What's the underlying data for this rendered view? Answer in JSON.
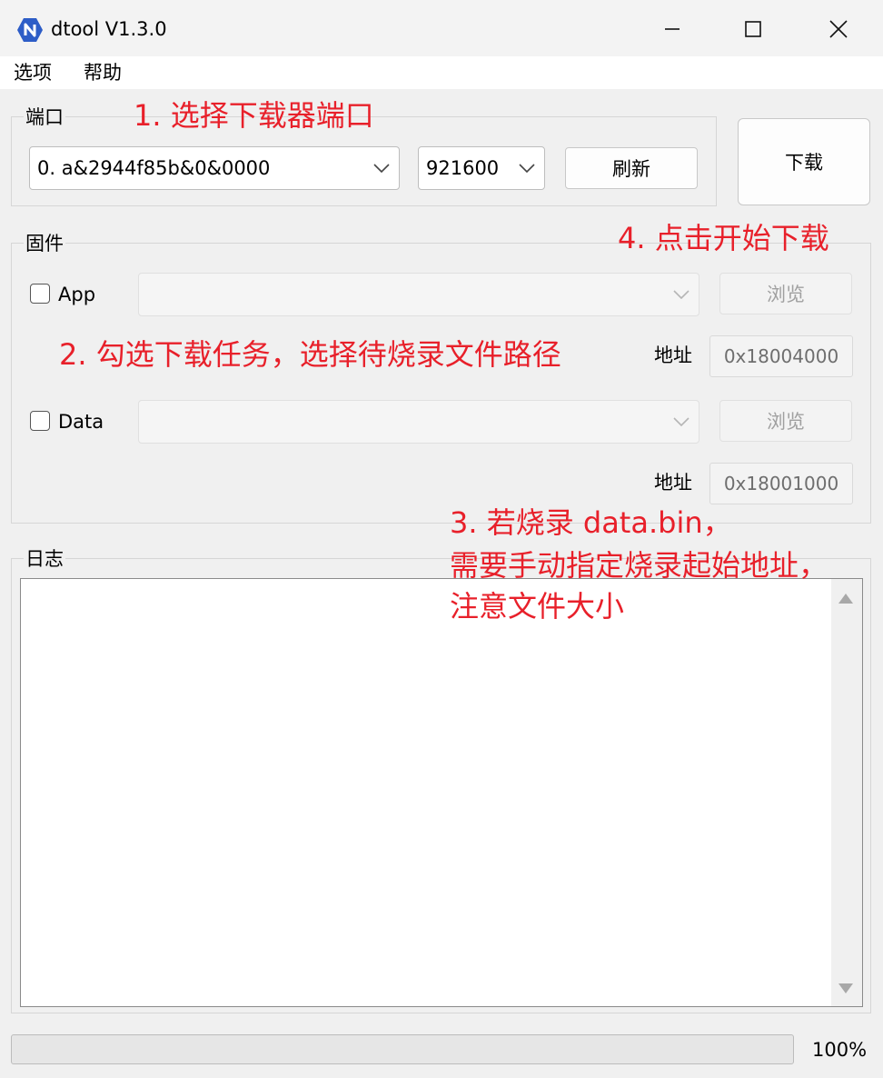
{
  "window": {
    "title": "dtool V1.3.0"
  },
  "menu": [
    "选项",
    "帮助"
  ],
  "port_group": {
    "label": "端口",
    "port_value": "0. a&2944f85b&0&0000",
    "baud_value": "921600",
    "refresh_label": "刷新"
  },
  "download_label": "下载",
  "firmware_group": {
    "label": "固件",
    "app": {
      "label": "App",
      "checked": false,
      "path": "",
      "browse_label": "浏览",
      "address_label": "地址",
      "address": "0x18004000"
    },
    "data": {
      "label": "Data",
      "checked": false,
      "path": "",
      "browse_label": "浏览",
      "address_label": "地址",
      "address": "0x18001000"
    }
  },
  "log_group": {
    "label": "日志"
  },
  "progress": {
    "value": 0,
    "text": "100%"
  },
  "annotations": {
    "a1": "1. 选择下载器端口",
    "a2": "2. 勾选下载任务，选择待烧录文件路径",
    "a3_line1": "3. 若烧录 data.bin，",
    "a3_line2": "需要手动指定烧录起始地址，",
    "a3_line3": "注意文件大小",
    "a4": "4. 点击开始下载"
  },
  "colors": {
    "annotation": "#e8202a",
    "app_icon": "#2d5dc7"
  }
}
